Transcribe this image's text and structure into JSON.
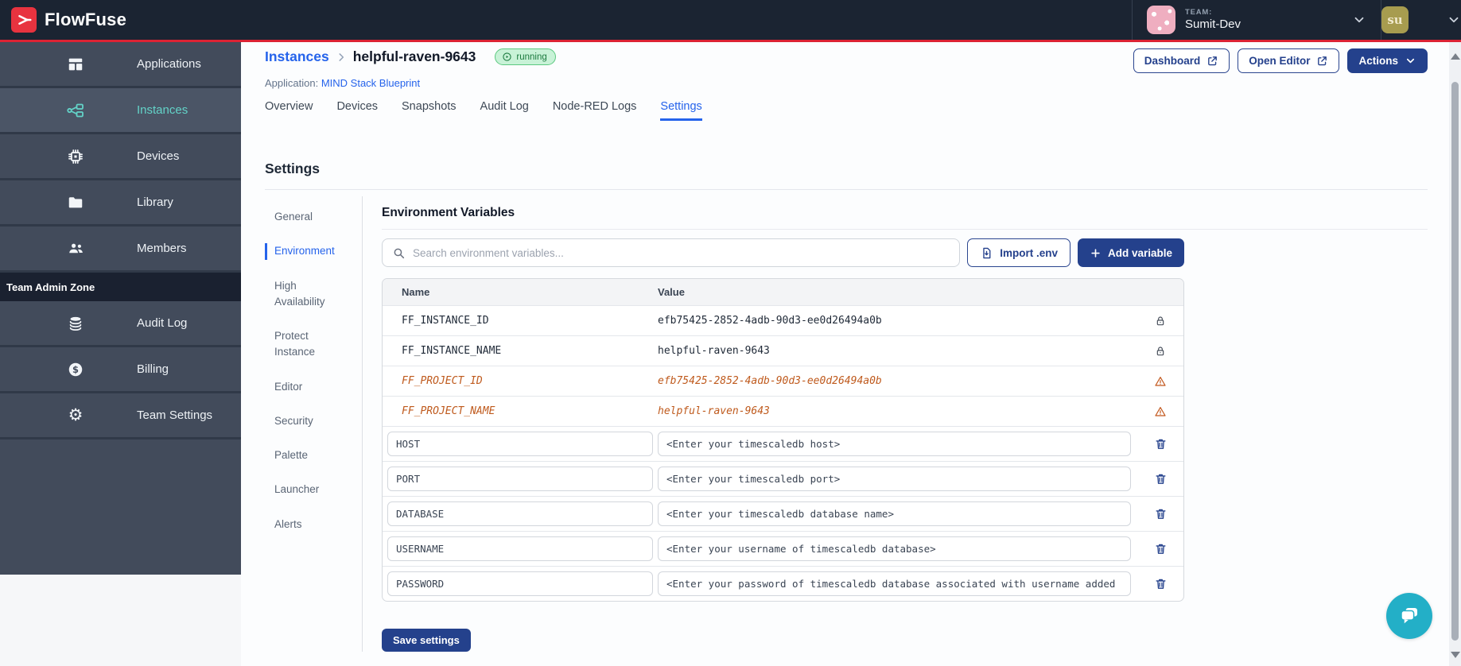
{
  "topbar": {
    "brand": "FlowFuse",
    "team_label": "TEAM:",
    "team_name": "Sumit-Dev",
    "user_initials": "su"
  },
  "sidebar": {
    "items": [
      {
        "label": "Applications",
        "icon": "apps-grid-icon"
      },
      {
        "label": "Instances",
        "icon": "instances-icon"
      },
      {
        "label": "Devices",
        "icon": "chip-icon"
      },
      {
        "label": "Library",
        "icon": "folder-icon"
      },
      {
        "label": "Members",
        "icon": "people-icon"
      }
    ],
    "active_item": "Instances",
    "admin_zone_label": "Team Admin Zone",
    "admin_items": [
      {
        "label": "Audit Log",
        "icon": "database-icon"
      },
      {
        "label": "Billing",
        "icon": "dollar-icon"
      },
      {
        "label": "Team Settings",
        "icon": "gear-icon"
      }
    ]
  },
  "header": {
    "breadcrumb_parent": "Instances",
    "breadcrumb_current": "helpful-raven-9643",
    "status_badge": "running",
    "application_label": "Application:",
    "application_name": "MIND Stack Blueprint",
    "dashboard_label": "Dashboard",
    "open_editor_label": "Open Editor",
    "actions_label": "Actions"
  },
  "tabs": {
    "items": [
      "Overview",
      "Devices",
      "Snapshots",
      "Audit Log",
      "Node-RED Logs",
      "Settings"
    ],
    "active": "Settings"
  },
  "settings": {
    "title": "Settings",
    "subnav": [
      "General",
      "Environment",
      "High Availability",
      "Protect Instance",
      "Editor",
      "Security",
      "Palette",
      "Launcher",
      "Alerts"
    ],
    "active": "Environment"
  },
  "env": {
    "title": "Environment Variables",
    "search_placeholder": "Search environment variables...",
    "import_label": "Import .env",
    "add_label": "Add variable",
    "columns": {
      "name": "Name",
      "value": "Value"
    },
    "locked_rows": [
      {
        "name": "FF_INSTANCE_ID",
        "value": "efb75425-2852-4adb-90d3-ee0d26494a0b"
      },
      {
        "name": "FF_INSTANCE_NAME",
        "value": "helpful-raven-9643"
      }
    ],
    "warning_rows": [
      {
        "name": "FF_PROJECT_ID",
        "value": "efb75425-2852-4adb-90d3-ee0d26494a0b"
      },
      {
        "name": "FF_PROJECT_NAME",
        "value": "helpful-raven-9643"
      }
    ],
    "editable_rows": [
      {
        "name": "HOST",
        "value": "<Enter your timescaledb host>"
      },
      {
        "name": "PORT",
        "value": "<Enter your timescaledb port>"
      },
      {
        "name": "DATABASE",
        "value": "<Enter your timescaledb database name>"
      },
      {
        "name": "USERNAME",
        "value": "<Enter your username of timescaledb database>"
      },
      {
        "name": "PASSWORD",
        "value": "<Enter your password of timescaledb database associated with username added"
      }
    ],
    "save_label": "Save settings"
  },
  "colors": {
    "brand_red": "#DC2334",
    "topbar_bg": "#1B2432",
    "sidebar_bg": "#424B5B",
    "accent_teal": "#63D3C8",
    "link_blue": "#2563EB",
    "button_navy": "#24418C",
    "warning_orange": "#BF5A1D",
    "running_green": "#1C7A3F",
    "chat_teal": "#23AFC7"
  }
}
